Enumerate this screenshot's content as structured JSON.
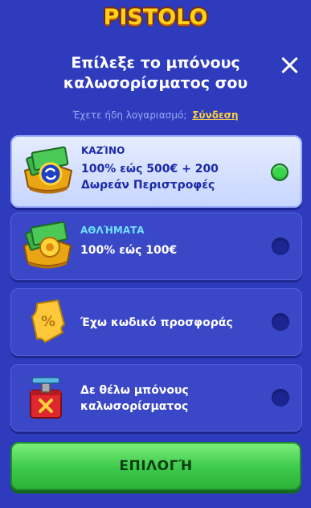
{
  "brand": {
    "logo_text": "PISTOLO"
  },
  "header": {
    "title_line1": "Επίλεξε το μπόνους",
    "title_line2": "καλωσορίσματος σου"
  },
  "login": {
    "question": "Έχετε ήδη λογαριασμό;",
    "link": "Σύνδεση"
  },
  "options": [
    {
      "category": "ΚΑΖΊΝΟ",
      "line1": "100% εώς 500€ + 200",
      "line2": "Δωρεάν Περιστροφές",
      "selected": true,
      "icon": "casino-cash-icon"
    },
    {
      "category": "ΑΘΛΉΜΑΤΑ",
      "line1": "100% εώς 100€",
      "selected": false,
      "icon": "sports-cash-icon"
    },
    {
      "line1": "Έχω κωδικό προσφοράς",
      "selected": false,
      "icon": "percent-ticket-icon"
    },
    {
      "line1": "Δε θέλω μπόνους",
      "line2": "καλωσορίσματος",
      "selected": false,
      "icon": "no-bonus-box-icon"
    }
  ],
  "submit": {
    "label": "ΕΠΙΛΟΓΉ"
  },
  "colors": {
    "background": "#2e3bbd",
    "accent_green": "#3cc94a",
    "link_yellow": "#ffd23c"
  }
}
